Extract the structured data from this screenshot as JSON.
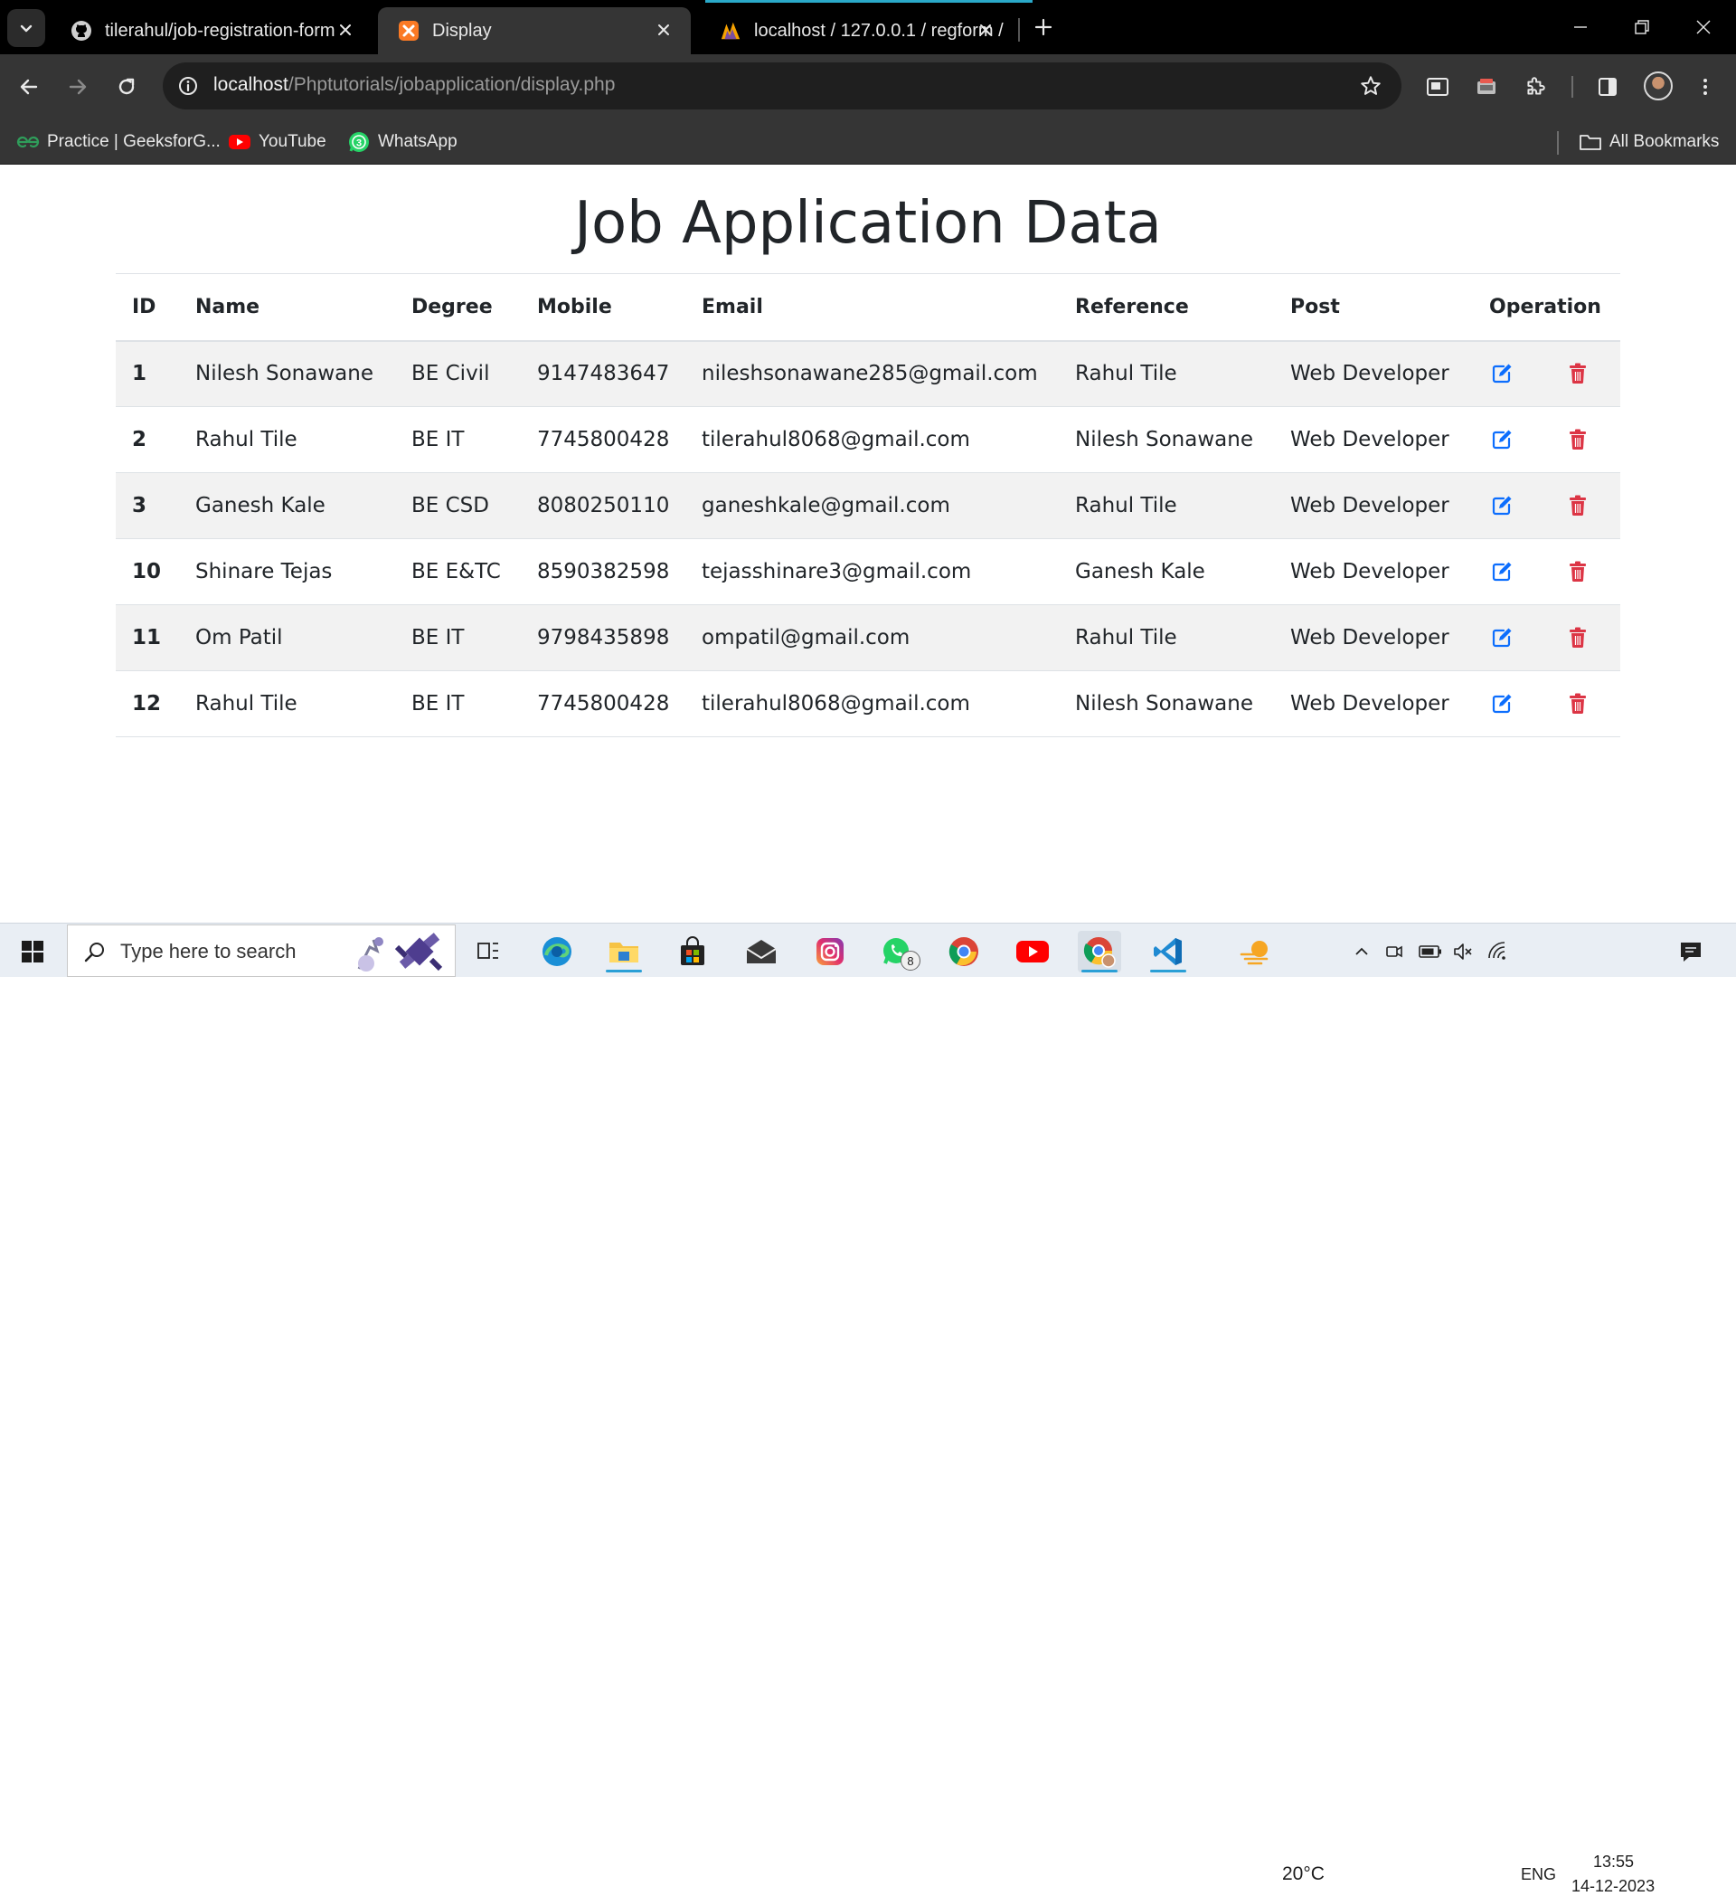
{
  "browser": {
    "tabs": [
      {
        "title": "tilerahul/job-registration-form",
        "icon": "github-icon",
        "active": false
      },
      {
        "title": "Display",
        "icon": "xampp-icon",
        "active": true
      },
      {
        "title": "localhost / 127.0.0.1 / regform /",
        "icon": "phpmyadmin-icon",
        "active": false
      }
    ],
    "url_host": "localhost",
    "url_path": "/Phptutorials/jobapplication/display.php",
    "bookmarks": [
      {
        "label": "Practice | GeeksforG...",
        "icon": "geeksforgeeks-icon"
      },
      {
        "label": "YouTube",
        "icon": "youtube-icon"
      },
      {
        "label": "WhatsApp",
        "icon": "whatsapp-icon"
      }
    ],
    "all_bookmarks": "All Bookmarks"
  },
  "page": {
    "title": "Job Application Data",
    "columns": [
      "ID",
      "Name",
      "Degree",
      "Mobile",
      "Email",
      "Reference",
      "Post",
      "Operation"
    ],
    "rows": [
      {
        "id": "1",
        "name": "Nilesh Sonawane",
        "degree": "BE Civil",
        "mobile": "9147483647",
        "email": "nileshsonawane285@gmail.com",
        "reference": "Rahul Tile",
        "post": "Web Developer"
      },
      {
        "id": "2",
        "name": "Rahul Tile",
        "degree": "BE IT",
        "mobile": "7745800428",
        "email": "tilerahul8068@gmail.com",
        "reference": "Nilesh Sonawane",
        "post": "Web Developer"
      },
      {
        "id": "3",
        "name": "Ganesh Kale",
        "degree": "BE CSD",
        "mobile": "8080250110",
        "email": "ganeshkale@gmail.com",
        "reference": "Rahul Tile",
        "post": "Web Developer"
      },
      {
        "id": "10",
        "name": "Shinare Tejas",
        "degree": "BE E&TC",
        "mobile": "8590382598",
        "email": "tejasshinare3@gmail.com",
        "reference": "Ganesh Kale",
        "post": "Web Developer"
      },
      {
        "id": "11",
        "name": "Om Patil",
        "degree": "BE IT",
        "mobile": "9798435898",
        "email": "ompatil@gmail.com",
        "reference": "Rahul Tile",
        "post": "Web Developer"
      },
      {
        "id": "12",
        "name": "Rahul Tile",
        "degree": "BE IT",
        "mobile": "7745800428",
        "email": "tilerahul8068@gmail.com",
        "reference": "Nilesh Sonawane",
        "post": "Web Developer"
      }
    ],
    "colors": {
      "edit": "#0d6efd",
      "delete": "#dc3545",
      "stripe": "#f2f2f2"
    }
  },
  "taskbar": {
    "search_placeholder": "Type here to search",
    "weather": "20°C",
    "language": "ENG",
    "time": "13:55",
    "date": "14-12-2023",
    "whatsapp_badge": "8"
  }
}
